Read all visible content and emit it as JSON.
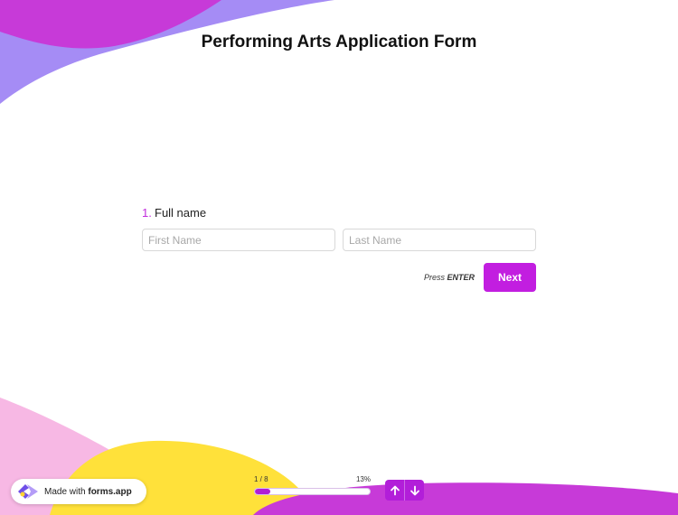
{
  "form": {
    "title": "Performing Arts Application Form"
  },
  "question": {
    "number": "1.",
    "label": "Full name",
    "first_name_placeholder": "First Name",
    "last_name_placeholder": "Last Name",
    "first_name_value": "",
    "last_name_value": ""
  },
  "actions": {
    "press_text": "Press",
    "enter_key": "ENTER",
    "next_label": "Next"
  },
  "badge": {
    "made_with": "Made with",
    "brand": "forms.app",
    "logo_icon": "forms-app-logo-icon"
  },
  "progress": {
    "step_text": "1 / 8",
    "percent_text": "13%",
    "fraction": 0.13
  },
  "nav": {
    "up_icon": "arrow-up-icon",
    "down_icon": "arrow-down-icon"
  },
  "colors": {
    "accent": "#c21ee0",
    "blob_magenta": "#c73ad8",
    "blob_purple": "#a58cf5",
    "blob_pink": "#f7b8e4",
    "blob_yellow": "#ffe13a"
  }
}
